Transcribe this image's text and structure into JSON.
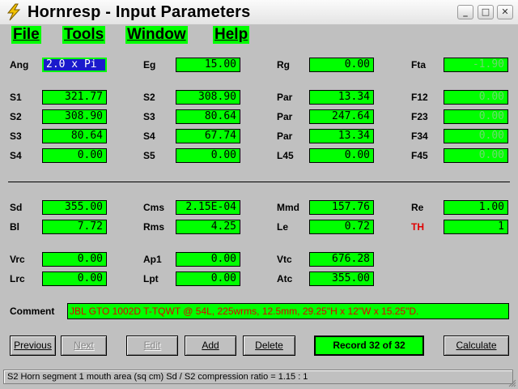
{
  "window": {
    "title": "Hornresp - Input Parameters",
    "minimize_glyph": "_",
    "maximize_glyph": "□",
    "close_glyph": "✕"
  },
  "menu": [
    "File",
    "Tools",
    "Window",
    "Help"
  ],
  "params": {
    "ang": {
      "label": "Ang",
      "value": "2.0 x Pi"
    },
    "eg": {
      "label": "Eg",
      "value": "15.00"
    },
    "rg": {
      "label": "Rg",
      "value": "0.00"
    },
    "fta": {
      "label": "Fta",
      "value": "-1.90"
    },
    "s1": {
      "label": "S1",
      "value": "321.77"
    },
    "s2a": {
      "label": "S2",
      "value": "308.90"
    },
    "par1": {
      "label": "Par",
      "value": "13.34"
    },
    "f12": {
      "label": "F12",
      "value": "0.00"
    },
    "s2b": {
      "label": "S2",
      "value": "308.90"
    },
    "s3a": {
      "label": "S3",
      "value": "80.64"
    },
    "par2": {
      "label": "Par",
      "value": "247.64"
    },
    "f23": {
      "label": "F23",
      "value": "0.00"
    },
    "s3b": {
      "label": "S3",
      "value": "80.64"
    },
    "s4a": {
      "label": "S4",
      "value": "67.74"
    },
    "par3": {
      "label": "Par",
      "value": "13.34"
    },
    "f34": {
      "label": "F34",
      "value": "0.00"
    },
    "s4b": {
      "label": "S4",
      "value": "0.00"
    },
    "s5": {
      "label": "S5",
      "value": "0.00"
    },
    "l45": {
      "label": "L45",
      "value": "0.00"
    },
    "f45": {
      "label": "F45",
      "value": "0.00"
    },
    "sd": {
      "label": "Sd",
      "value": "355.00"
    },
    "cms": {
      "label": "Cms",
      "value": "2.15E-04"
    },
    "mmd": {
      "label": "Mmd",
      "value": "157.76"
    },
    "re": {
      "label": "Re",
      "value": "1.00"
    },
    "bl": {
      "label": "Bl",
      "value": "7.72"
    },
    "rms": {
      "label": "Rms",
      "value": "4.25"
    },
    "le": {
      "label": "Le",
      "value": "0.72"
    },
    "th": {
      "label": "TH",
      "value": "1"
    },
    "vrc": {
      "label": "Vrc",
      "value": "0.00"
    },
    "ap1": {
      "label": "Ap1",
      "value": "0.00"
    },
    "vtc": {
      "label": "Vtc",
      "value": "676.28"
    },
    "lrc": {
      "label": "Lrc",
      "value": "0.00"
    },
    "lpt": {
      "label": "Lpt",
      "value": "0.00"
    },
    "atc": {
      "label": "Atc",
      "value": "355.00"
    }
  },
  "comment": {
    "label": "Comment",
    "value": "JBL GTO 1002D T-TQWT @ 54L, 225wrms, 12.5mm, 29.25\"H x 12\"W x 15.25\"D."
  },
  "buttons": {
    "previous": "Previous",
    "next": "Next",
    "edit": "Edit",
    "add": "Add",
    "delete": "Delete",
    "record": "Record 32 of 32",
    "calculate": "Calculate"
  },
  "status": "S2   Horn segment 1 mouth area  (sq cm)   Sd / S2 compression ratio = 1.15 : 1",
  "colors": {
    "field_bg": "#00ff00",
    "window_bg": "#c0c0c0",
    "selected_field_bg": "#1a1acc",
    "comment_text": "#e00000",
    "th_label": "#e00000"
  }
}
